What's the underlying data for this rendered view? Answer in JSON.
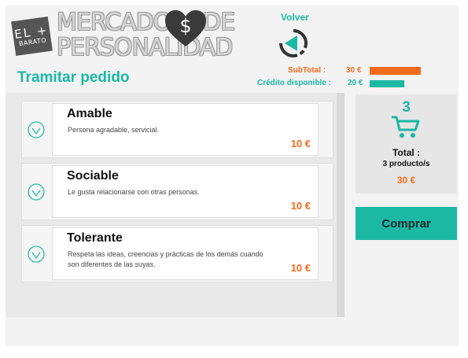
{
  "brand": {
    "badge_top": "EL +",
    "badge_bottom": "BARATO",
    "line1_a": "MERCADO",
    "line1_b": "DE",
    "line2": "PERSONALIDAD",
    "heart_symbol": "$"
  },
  "nav": {
    "volver_label": "Volver"
  },
  "budget": {
    "subtotal_label": "SubTotal :",
    "subtotal_value": "30 €",
    "subtotal_fraction": 1.0,
    "credit_label": "Crédito disponible :",
    "credit_value": "20 €",
    "credit_fraction": 0.67
  },
  "page": {
    "title": "Tramitar pedido"
  },
  "items": [
    {
      "title": "Amable",
      "description": "Persona agradable, servicial.",
      "price": "10 €"
    },
    {
      "title": "Sociable",
      "description": "Le gusta relacionarse con otras personas.",
      "price": "10 €"
    },
    {
      "title": "Tolerante",
      "description": "Respeta las ideas, creencias y prácticas de los demás cuando son diferentes de las suyas.",
      "price": "10 €"
    }
  ],
  "summary": {
    "count": "3",
    "total_label": "Total :",
    "products": "3 producto/s",
    "price": "30 €"
  },
  "actions": {
    "comprar_label": "Comprar"
  },
  "colors": {
    "accent": "#1bb8a4",
    "orange": "#f26a1b",
    "frame": "#f3f3f3"
  }
}
